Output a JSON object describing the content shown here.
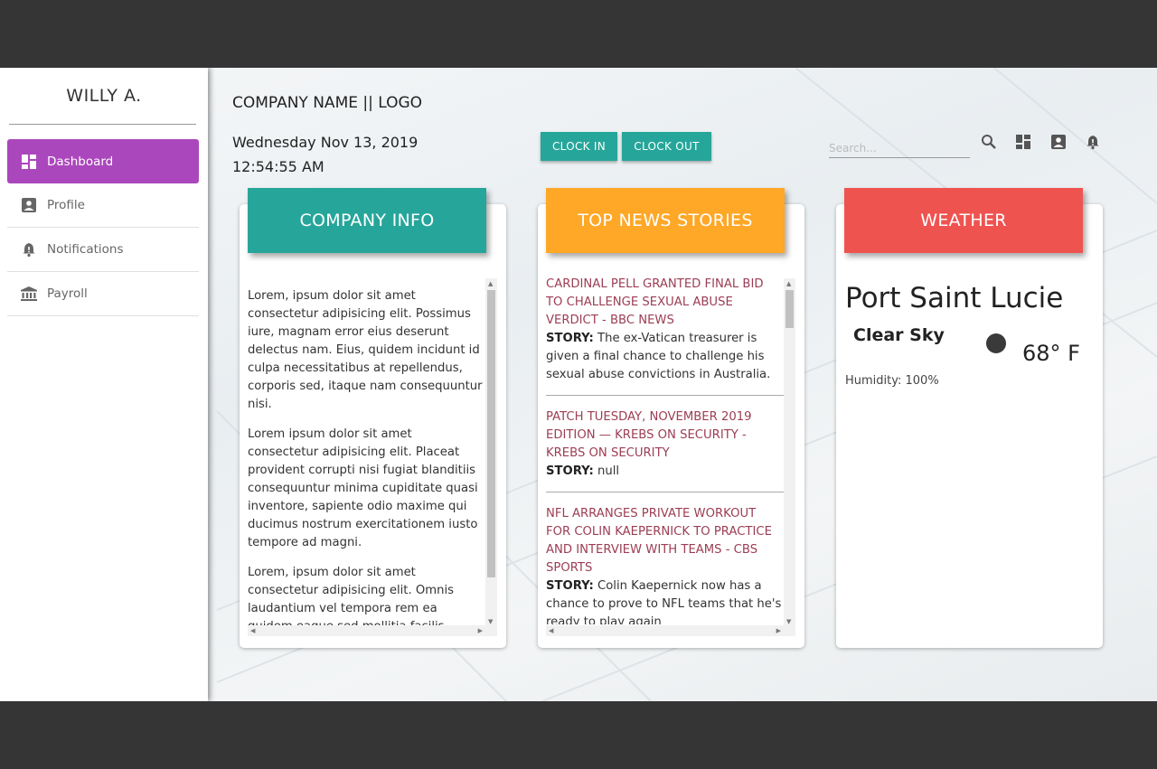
{
  "user": {
    "name": "WILLY A."
  },
  "sidebar": {
    "items": [
      {
        "label": "Dashboard",
        "icon": "dashboard-icon"
      },
      {
        "label": "Profile",
        "icon": "account-box-icon"
      },
      {
        "label": "Notifications",
        "icon": "bell-icon"
      },
      {
        "label": "Payroll",
        "icon": "bank-icon"
      }
    ]
  },
  "header": {
    "company": "COMPANY NAME || LOGO",
    "date": "Wednesday Nov 13, 2019",
    "time": "12:54:55 AM",
    "clock_in": "CLOCK IN",
    "clock_out": "CLOCK OUT",
    "search_placeholder": "Search..."
  },
  "cards": {
    "company": {
      "title": "COMPANY INFO",
      "paragraphs": [
        "Lorem, ipsum dolor sit amet consectetur adipisicing elit. Possimus iure, magnam error eius deserunt delectus nam. Eius, quidem incidunt id culpa necessitatibus at repellendus, corporis sed, itaque nam consequuntur nisi.",
        "Lorem ipsum dolor sit amet consectetur adipisicing elit. Placeat provident corrupti nisi fugiat blanditiis consequuntur minima cupiditate quasi inventore, sapiente odio maxime qui ducimus nostrum exercitationem iusto tempore ad magni.",
        "Lorem, ipsum dolor sit amet consectetur adipisicing elit. Omnis laudantium vel tempora rem ea quidem eaque sed mollitia facilis"
      ]
    },
    "news": {
      "title": "TOP NEWS STORIES",
      "story_label": "STORY:",
      "items": [
        {
          "title": "CARDINAL PELL GRANTED FINAL BID TO CHALLENGE SEXUAL ABUSE VERDICT - BBC NEWS",
          "story": "The ex-Vatican treasurer is given a final chance to challenge his sexual abuse convictions in Australia."
        },
        {
          "title": "PATCH TUESDAY, NOVEMBER 2019 EDITION — KREBS ON SECURITY - KREBS ON SECURITY",
          "story": "null"
        },
        {
          "title": "NFL ARRANGES PRIVATE WORKOUT FOR COLIN KAEPERNICK TO PRACTICE AND INTERVIEW WITH TEAMS - CBS SPORTS",
          "story": "Colin Kaepernick now has a chance to prove to NFL teams that he's ready to play again"
        }
      ]
    },
    "weather": {
      "title": "WEATHER",
      "city": "Port Saint Lucie",
      "condition": "Clear Sky",
      "temp": "68° F",
      "humidity": "Humidity: 100%"
    }
  },
  "colors": {
    "active_nav": "#ab47bc",
    "teal": "#26a69a",
    "orange": "#ffa726",
    "red": "#ef5350",
    "news_title": "#9c3d54"
  }
}
